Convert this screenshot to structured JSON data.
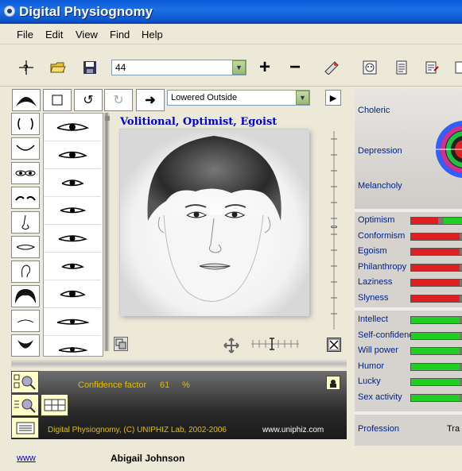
{
  "window": {
    "title": "Digital Physiognomy"
  },
  "menu": [
    "File",
    "Edit",
    "View",
    "Find",
    "Help"
  ],
  "toolbar": {
    "face_number": "44",
    "buttons": [
      "help-cursor-icon",
      "open-folder-icon",
      "save-disk-icon",
      "plus-icon",
      "minus-icon",
      "wizard-icon",
      "face-icon",
      "report-icon",
      "print-icon"
    ]
  },
  "edit": {
    "shape_select": "Lowered Outside"
  },
  "portrait": {
    "caption": "Volitional, Optimist, Egoist"
  },
  "temperament": {
    "labels": [
      "Choleric",
      "Depression",
      "Melancholy"
    ]
  },
  "traits_negative": [
    {
      "label": "Optimism",
      "value": 0.5
    },
    {
      "label": "Conformism",
      "value": 0.9
    },
    {
      "label": "Egoism",
      "value": 0.9
    },
    {
      "label": "Philanthropy",
      "value": 0.9
    },
    {
      "label": "Laziness",
      "value": 0.9
    },
    {
      "label": "Slyness",
      "value": 0.9
    }
  ],
  "traits_positive": [
    {
      "label": "Intellect",
      "value": 0.9
    },
    {
      "label": "Self-confidence",
      "value": 0.9
    },
    {
      "label": "Will power",
      "value": 0.9
    },
    {
      "label": "Humor",
      "value": 0.9
    },
    {
      "label": "Lucky",
      "value": 0.9
    },
    {
      "label": "Sex activity",
      "value": 0.9
    }
  ],
  "profession": {
    "label": "Profession",
    "value": "Tra"
  },
  "bottom": {
    "confidence_label": "Confidence factor",
    "confidence_value": "61",
    "confidence_unit": "%",
    "copyright": "Digital Physiognomy, (C) UNIPHIZ Lab, 2002-2006",
    "website": "www.uniphiz.com"
  },
  "status": {
    "link": "www",
    "name": "Abigail Johnson"
  },
  "colors": {
    "titlebar": "#1f6fe6",
    "caption": "#0000cc",
    "bottom_text": "#e0c000",
    "bar_red": "#e02020",
    "bar_green": "#20d020"
  }
}
